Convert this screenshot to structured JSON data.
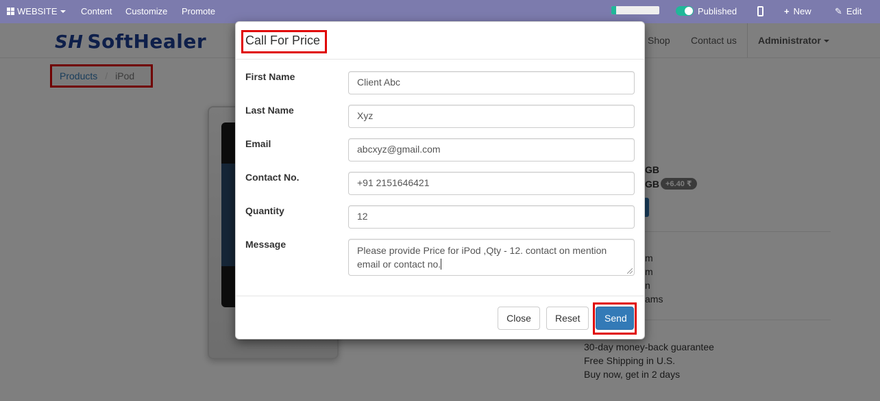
{
  "admin_bar": {
    "website_label": "WEBSITE",
    "content_label": "Content",
    "customize_label": "Customize",
    "promote_label": "Promote",
    "progress_fraction": 0.1,
    "published_label": "Published",
    "new_label": "New",
    "edit_label": "Edit"
  },
  "site_header": {
    "logo_text": "SoftHealer",
    "logo_mark": "SH",
    "nav": {
      "shop": "Shop",
      "contact_us": "Contact us",
      "admin": "Administrator"
    }
  },
  "breadcrumb": {
    "items": [
      "Products",
      "iPod"
    ]
  },
  "product_background": {
    "partial_lines": [
      "GB",
      "GB",
      "m",
      "m",
      "n",
      "ams"
    ],
    "price_badge": "+6.40 ₹",
    "guarantee_lines": [
      "30-day money-back guarantee",
      "Free Shipping in U.S.",
      "Buy now, get in 2 days"
    ]
  },
  "modal": {
    "title": "Call For Price",
    "fields": [
      {
        "label": "First Name",
        "value": "Client Abc"
      },
      {
        "label": "Last Name",
        "value": "Xyz"
      },
      {
        "label": "Email",
        "value": "abcxyz@gmail.com"
      },
      {
        "label": "Contact No.",
        "value": "+91 2151646421"
      },
      {
        "label": "Quantity",
        "value": "12"
      },
      {
        "label": "Message",
        "value": "Please provide Price for iPod ,Qty - 12. contact on mention email or contact no."
      }
    ],
    "buttons": {
      "close": "Close",
      "reset": "Reset",
      "send": "Send"
    }
  },
  "colors": {
    "admin_bar": "#7c7bad",
    "primary": "#337ab7",
    "highlight": "#e00000",
    "toggle_on": "#21b799"
  }
}
